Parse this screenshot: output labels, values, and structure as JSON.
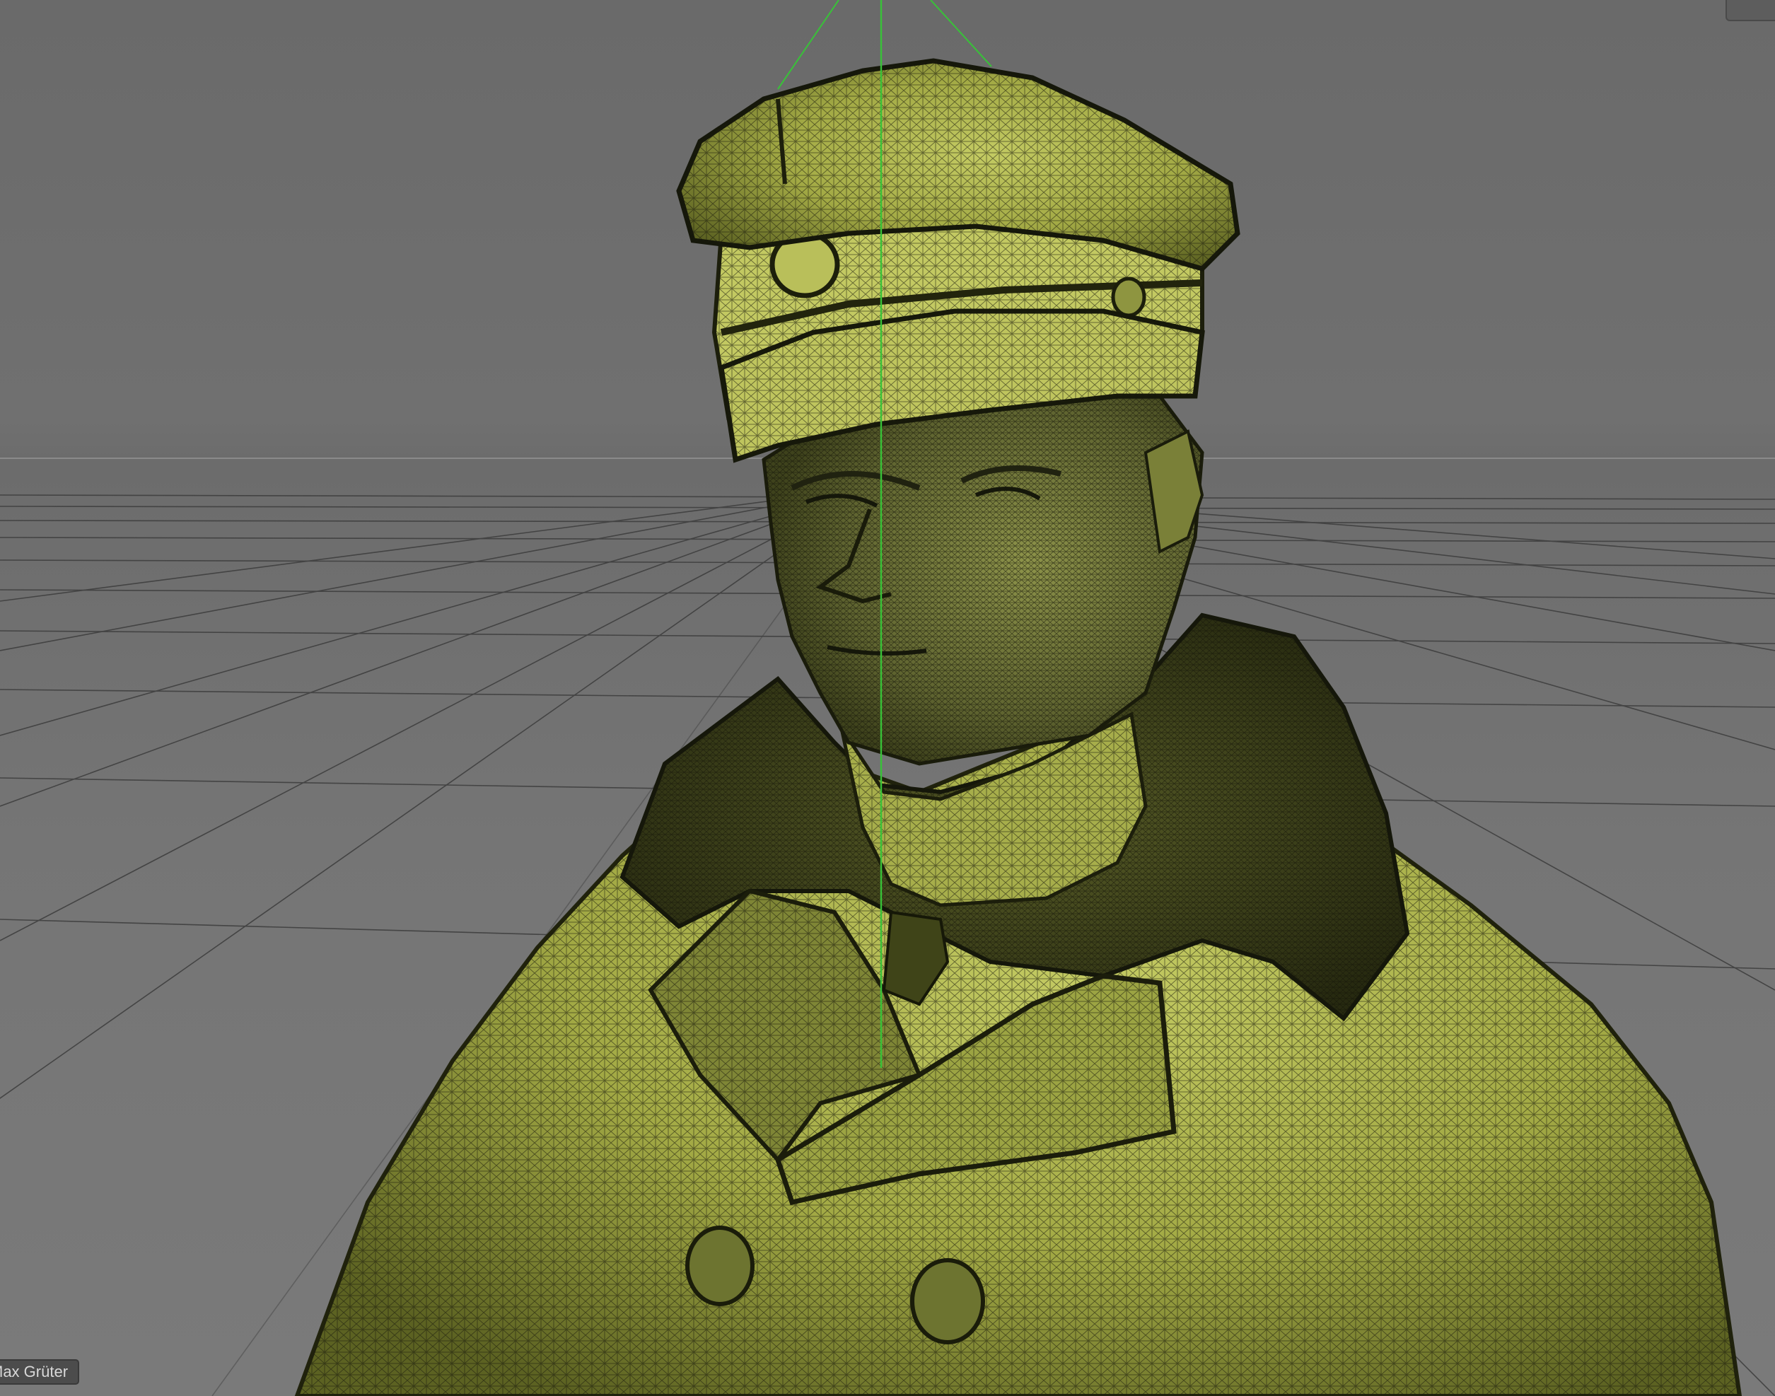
{
  "viewport": {
    "background_color": "#707070",
    "grid_color": "#3c3c3c",
    "horizon_color": "#8a8a8a",
    "y_axis_color": "#38c238",
    "mesh_fill_color": "#a9b04a",
    "mesh_wire_color": "#1a1a0c"
  },
  "credit_label": "Max Grüter",
  "icons": {
    "corner_button": "view-panel-toggle-icon"
  }
}
